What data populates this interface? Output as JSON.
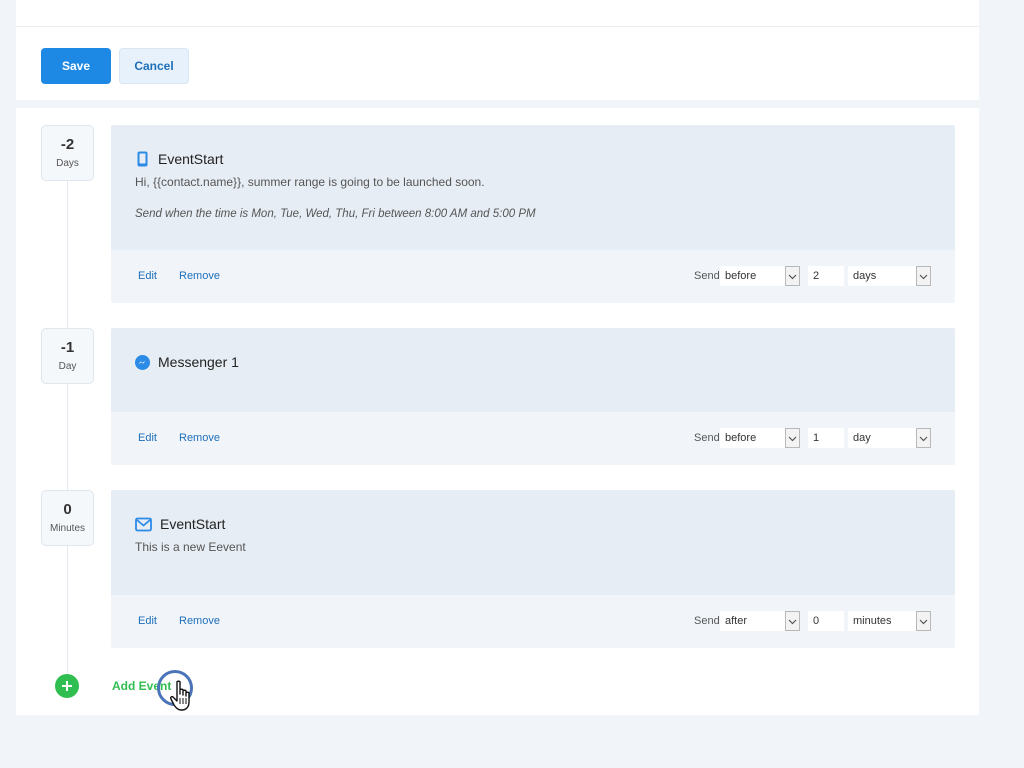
{
  "toolbar": {
    "save_label": "Save",
    "cancel_label": "Cancel"
  },
  "colors": {
    "primary": "#1e88e5",
    "link": "#1e6fba",
    "success": "#2fbe4f",
    "card_header": "#e7edf4",
    "card_footer": "#f1f5f9"
  },
  "events": [
    {
      "offset": "-2",
      "unit": "Days",
      "icon": "mobile-phone-icon",
      "title": "EventStart",
      "message": "Hi, {{contact.name}}, summer range is going to be launched soon.",
      "note": "Send when the time is Mon, Tue, Wed, Thu, Fri between 8:00 AM and 5:00 PM",
      "edit_label": "Edit",
      "remove_label": "Remove",
      "send_label": "Send",
      "direction": "before",
      "amount": "2",
      "amount_unit": "days"
    },
    {
      "offset": "-1",
      "unit": "Day",
      "icon": "messenger-icon",
      "title": "Messenger 1",
      "message": "",
      "note": "",
      "edit_label": "Edit",
      "remove_label": "Remove",
      "send_label": "Send",
      "direction": "before",
      "amount": "1",
      "amount_unit": "day"
    },
    {
      "offset": "0",
      "unit": "Minutes",
      "icon": "email-icon",
      "title": "EventStart",
      "message": "This is a new Eevent",
      "note": "",
      "edit_label": "Edit",
      "remove_label": "Remove",
      "send_label": "Send",
      "direction": "after",
      "amount": "0",
      "amount_unit": "minutes"
    }
  ],
  "add_event": {
    "label": "Add Event",
    "icon": "plus-circle-icon"
  }
}
